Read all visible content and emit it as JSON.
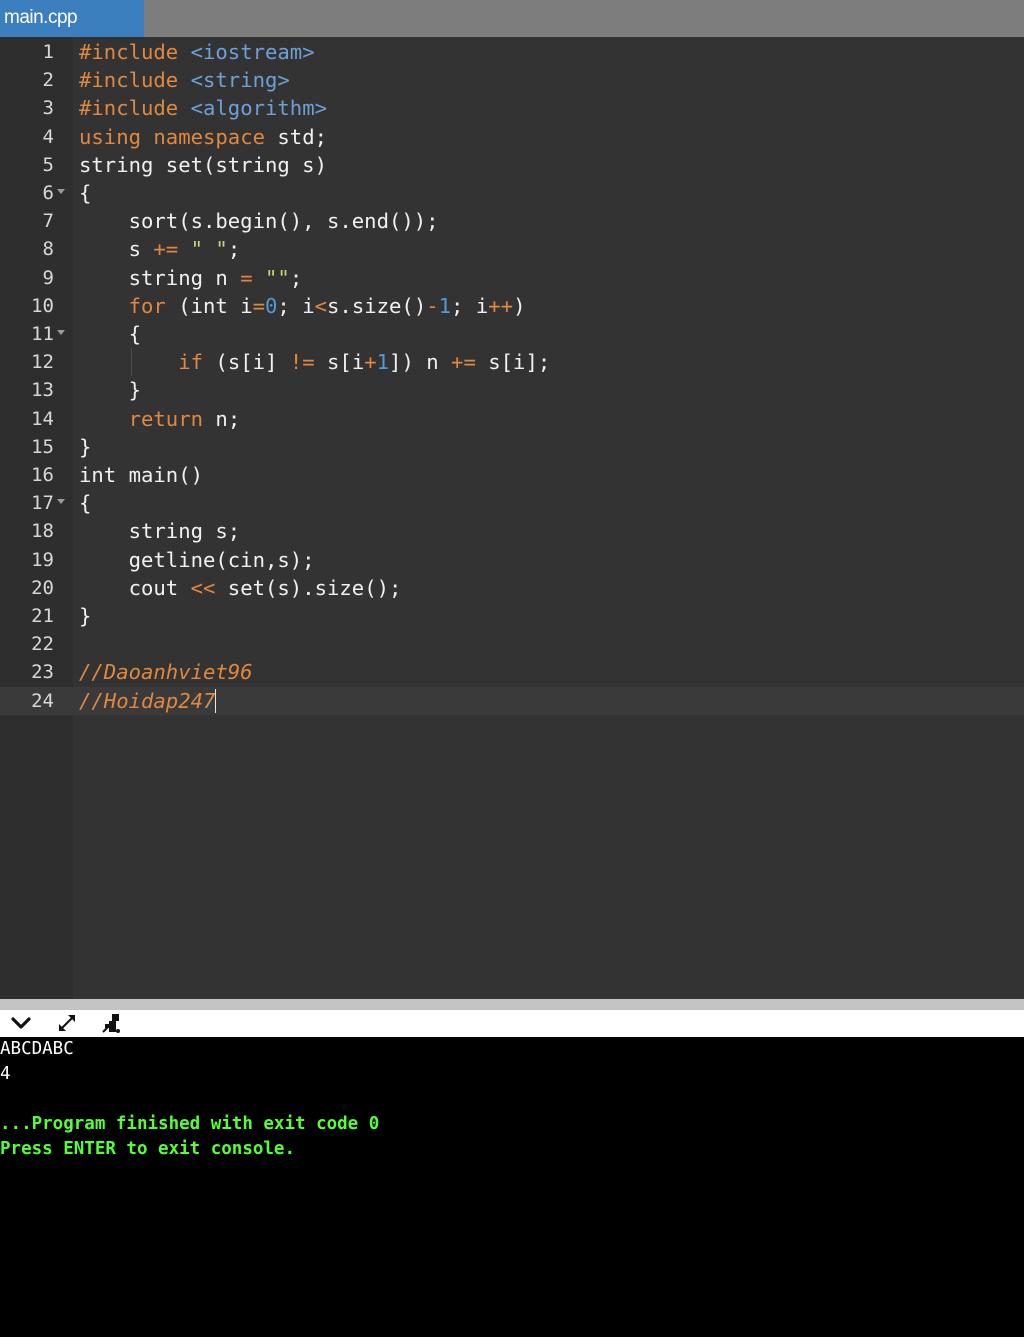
{
  "tab": {
    "label": "main.cpp"
  },
  "editor": {
    "lines": [
      {
        "n": "1"
      },
      {
        "n": "2"
      },
      {
        "n": "3"
      },
      {
        "n": "4"
      },
      {
        "n": "5"
      },
      {
        "n": "6"
      },
      {
        "n": "7"
      },
      {
        "n": "8"
      },
      {
        "n": "9"
      },
      {
        "n": "10"
      },
      {
        "n": "11"
      },
      {
        "n": "12"
      },
      {
        "n": "13"
      },
      {
        "n": "14"
      },
      {
        "n": "15"
      },
      {
        "n": "16"
      },
      {
        "n": "17"
      },
      {
        "n": "18"
      },
      {
        "n": "19"
      },
      {
        "n": "20"
      },
      {
        "n": "21"
      },
      {
        "n": "22"
      },
      {
        "n": "23"
      },
      {
        "n": "24"
      }
    ],
    "code": [
      [
        [
          "k",
          "#include"
        ],
        [
          "p",
          " "
        ],
        [
          "h",
          "<iostream>"
        ]
      ],
      [
        [
          "k",
          "#include"
        ],
        [
          "p",
          " "
        ],
        [
          "h",
          "<string>"
        ]
      ],
      [
        [
          "k",
          "#include"
        ],
        [
          "p",
          " "
        ],
        [
          "h",
          "<algorithm>"
        ]
      ],
      [
        [
          "k",
          "using"
        ],
        [
          "p",
          " "
        ],
        [
          "k",
          "namespace"
        ],
        [
          "p",
          " std;"
        ]
      ],
      [
        [
          "p",
          "string set(string s)"
        ]
      ],
      [
        [
          "p",
          "{"
        ]
      ],
      [
        [
          "p",
          "    sort(s.begin(), s.end());"
        ]
      ],
      [
        [
          "p",
          "    s "
        ],
        [
          "o",
          "+="
        ],
        [
          "p",
          " "
        ],
        [
          "s",
          "\" \""
        ],
        [
          "p",
          ";"
        ]
      ],
      [
        [
          "p",
          "    string n "
        ],
        [
          "o",
          "="
        ],
        [
          "p",
          " "
        ],
        [
          "s",
          "\"\""
        ],
        [
          "p",
          ";"
        ]
      ],
      [
        [
          "p",
          "    "
        ],
        [
          "k",
          "for"
        ],
        [
          "p",
          " (int i"
        ],
        [
          "o",
          "="
        ],
        [
          "n",
          "0"
        ],
        [
          "p",
          "; i"
        ],
        [
          "o",
          "<"
        ],
        [
          "p",
          "s.size()"
        ],
        [
          "o",
          "-"
        ],
        [
          "n",
          "1"
        ],
        [
          "p",
          "; i"
        ],
        [
          "o",
          "++"
        ],
        [
          "p",
          ")"
        ]
      ],
      [
        [
          "p",
          "    {"
        ]
      ],
      [
        [
          "p",
          "        "
        ],
        [
          "k",
          "if"
        ],
        [
          "p",
          " (s[i] "
        ],
        [
          "o",
          "!="
        ],
        [
          "p",
          " s[i"
        ],
        [
          "o",
          "+"
        ],
        [
          "n",
          "1"
        ],
        [
          "p",
          "]) n "
        ],
        [
          "o",
          "+="
        ],
        [
          "p",
          " s[i];"
        ]
      ],
      [
        [
          "p",
          "    }"
        ]
      ],
      [
        [
          "p",
          "    "
        ],
        [
          "k",
          "return"
        ],
        [
          "p",
          " n;"
        ]
      ],
      [
        [
          "p",
          "}"
        ]
      ],
      [
        [
          "p",
          "int main()"
        ]
      ],
      [
        [
          "p",
          "{"
        ]
      ],
      [
        [
          "p",
          "    string s;"
        ]
      ],
      [
        [
          "p",
          "    getline(cin,s);"
        ]
      ],
      [
        [
          "p",
          "    cout "
        ],
        [
          "o",
          "<<"
        ],
        [
          "p",
          " set(s).size();"
        ]
      ],
      [
        [
          "p",
          "}"
        ]
      ],
      [],
      [
        [
          "c",
          "//Daoanhviet96"
        ]
      ],
      [
        [
          "c",
          "//Hoidap247"
        ]
      ]
    ],
    "fold_lines": [
      6,
      11,
      17
    ],
    "active_line": 24
  },
  "console": {
    "icons": [
      "chevron-down-icon",
      "expand-icon",
      "clear-console-icon"
    ],
    "output": [
      "ABCDABC",
      "4"
    ],
    "status": [
      "...Program finished with exit code 0",
      "Press ENTER to exit console."
    ]
  }
}
